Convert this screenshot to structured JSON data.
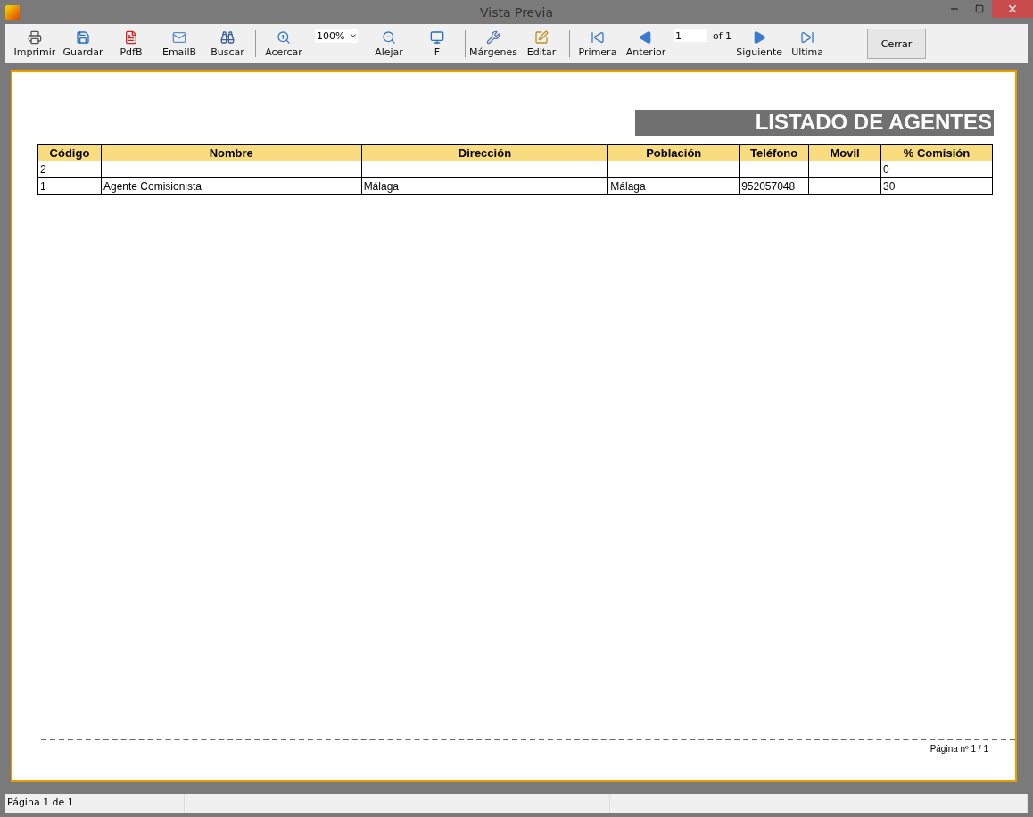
{
  "window": {
    "title": "Vista Previa"
  },
  "toolbar": [
    {
      "kind": "button",
      "label": "Imprimir"
    },
    {
      "kind": "button",
      "label": "Guardar"
    },
    {
      "kind": "button",
      "label": "PdfB"
    },
    {
      "kind": "button",
      "label": "EmailB"
    },
    {
      "kind": "button",
      "label": "Buscar"
    },
    {
      "kind": "separator"
    },
    {
      "kind": "button",
      "label": "Acercar"
    },
    {
      "kind": "zoom",
      "value": "100%"
    },
    {
      "kind": "button",
      "label": "Alejar"
    },
    {
      "kind": "button",
      "label": "F"
    },
    {
      "kind": "separator"
    },
    {
      "kind": "button",
      "label": "Márgenes"
    },
    {
      "kind": "button",
      "label": "Editar"
    },
    {
      "kind": "separator"
    },
    {
      "kind": "button",
      "label": "Primera"
    },
    {
      "kind": "button",
      "label": "Anterior"
    },
    {
      "kind": "page",
      "value": "1",
      "total": "of 1"
    },
    {
      "kind": "button",
      "label": "Siguiente"
    },
    {
      "kind": "button",
      "label": "Ultima"
    },
    {
      "kind": "close",
      "label": "Cerrar"
    }
  ],
  "report": {
    "title": "LISTADO DE AGENTES",
    "table": {
      "columns": [
        "Código",
        "Nombre",
        "Dirección",
        "Población",
        "Teléfono",
        "Movil",
        "% Comisión"
      ],
      "rows": [
        [
          "2",
          "",
          "",
          "",
          "",
          "",
          "0"
        ],
        [
          "1",
          "Agente Comisionista",
          "Málaga",
          "Málaga",
          "952057048",
          "",
          "30"
        ]
      ]
    },
    "footer": "Página nº 1 / 1"
  },
  "status_bar": [
    "Página 1 de 1"
  ]
}
